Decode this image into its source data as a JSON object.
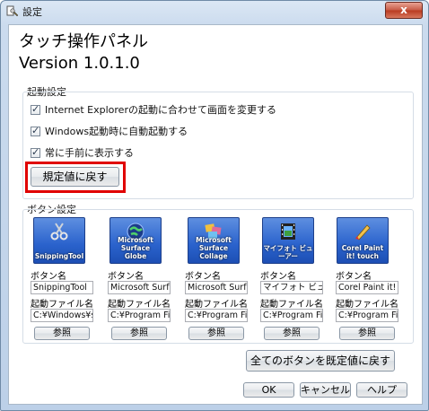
{
  "window": {
    "title": "設定",
    "close_label": "x"
  },
  "app": {
    "title_line1": "タッチ操作パネル",
    "title_line2": "Version 1.0.1.0"
  },
  "startup": {
    "group_label": "起動設定",
    "checkboxes": [
      {
        "label": "Internet Explorerの起動に合わせて画面を変更する",
        "checked": true
      },
      {
        "label": "Windows起動時に自動起動する",
        "checked": true
      },
      {
        "label": "常に手前に表示する",
        "checked": true
      }
    ],
    "reset_button": "規定値に戻す"
  },
  "buttons_section": {
    "group_label": "ボタン設定",
    "name_label": "ボタン名",
    "file_label": "起動ファイル名",
    "browse_label": "参照",
    "items": [
      {
        "tile": "SnippingTool",
        "name": "SnippingTool",
        "file": "C:¥Windows¥sys",
        "icon": "scissors-icon"
      },
      {
        "tile": "Microsoft Surface Globe",
        "name": "Microsoft Surfac",
        "file": "C:¥Program File",
        "icon": "globe-icon"
      },
      {
        "tile": "Microsoft Surface Collage",
        "name": "Microsoft Surfac",
        "file": "C:¥Program File",
        "icon": "collage-icon"
      },
      {
        "tile": "マイフォト ビューアー",
        "name": "マイフォト ビューア",
        "file": "C:¥Program File",
        "icon": "film-icon"
      },
      {
        "tile": "Corel Paint it! touch",
        "name": "Corel Paint it! to",
        "file": "C:¥Program File",
        "icon": "paint-icon"
      }
    ],
    "reset_all_button": "全てのボタンを既定値に戻す"
  },
  "footer": {
    "ok": "OK",
    "cancel": "キャンセル",
    "help": "ヘルプ"
  }
}
